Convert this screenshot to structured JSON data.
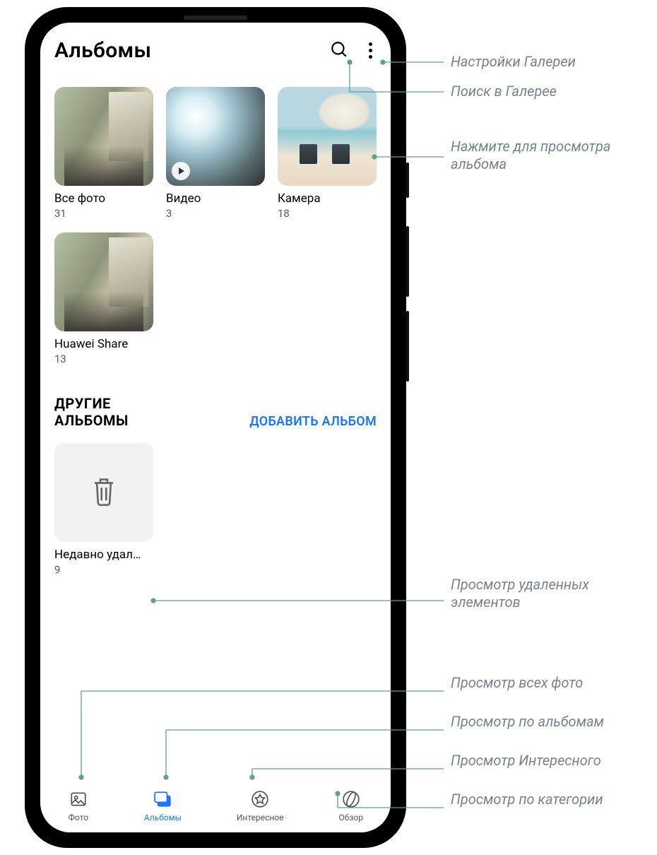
{
  "header": {
    "title": "Альбомы"
  },
  "albums": [
    {
      "name": "Все фото",
      "count": "31"
    },
    {
      "name": "Видео",
      "count": "3"
    },
    {
      "name": "Камера",
      "count": "18"
    },
    {
      "name": "Huawei Share",
      "count": "13"
    }
  ],
  "section": {
    "title": "ДРУГИЕ АЛЬБОМЫ",
    "add_label": "ДОБАВИТЬ АЛЬБОМ"
  },
  "other_albums": [
    {
      "name": "Недавно удал…",
      "count": "9"
    }
  ],
  "nav": [
    {
      "label": "Фото"
    },
    {
      "label": "Альбомы"
    },
    {
      "label": "Интересное"
    },
    {
      "label": "Обзор"
    }
  ],
  "callouts": {
    "settings": "Настройки Галереи",
    "search": "Поиск в Галерее",
    "view_album": "Нажмите для просмотра альбома",
    "deleted": "Просмотр удаленных элементов",
    "all_photos": "Просмотр всех фото",
    "by_albums": "Просмотр по альбомам",
    "highlights": "Просмотр Интересного",
    "by_category": "Просмотр по категории"
  }
}
